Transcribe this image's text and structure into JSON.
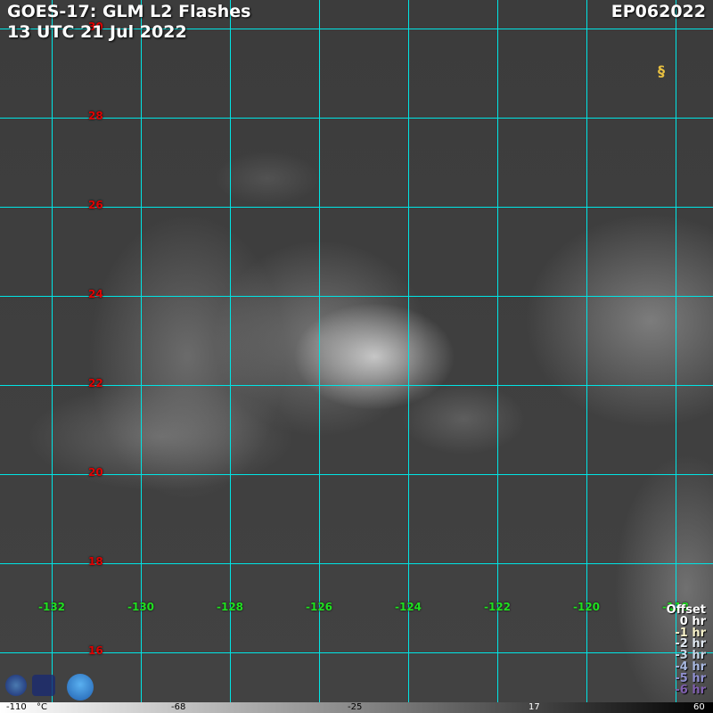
{
  "title": "GOES-17: GLM L2 Flashes",
  "datetime": "13 UTC 21 Jul 2022",
  "storm_id": "EP062022",
  "latitudes": [
    "30",
    "28",
    "26",
    "24",
    "22",
    "20",
    "18",
    "16"
  ],
  "longitudes": [
    "-132",
    "-130",
    "-128",
    "-126",
    "-124",
    "-122",
    "-120",
    "-118"
  ],
  "legend": {
    "title": "Offset",
    "items": [
      {
        "label": "0 hr",
        "color": "#ffffff"
      },
      {
        "label": "-1 hr",
        "color": "#f5f0c8"
      },
      {
        "label": "-2 hr",
        "color": "#e0e8f0"
      },
      {
        "label": "-3 hr",
        "color": "#c8d8e8"
      },
      {
        "label": "-4 hr",
        "color": "#a8b8e0"
      },
      {
        "label": "-5 hr",
        "color": "#9090d0"
      },
      {
        "label": "-6 hr",
        "color": "#8060b0"
      }
    ]
  },
  "colorbar": {
    "labels": [
      "-110",
      "°C",
      "-68",
      "-25",
      "17",
      "60"
    ]
  },
  "logos": [
    "CIRA",
    "RAMMB"
  ]
}
